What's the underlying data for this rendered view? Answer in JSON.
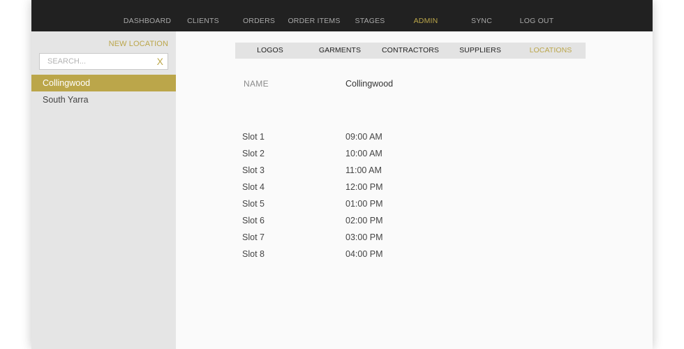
{
  "nav": {
    "items": [
      {
        "label": "DASHBOARD",
        "active": false
      },
      {
        "label": "CLIENTS",
        "active": false
      },
      {
        "label": "ORDERS",
        "active": false
      },
      {
        "label": "ORDER ITEMS",
        "active": false
      },
      {
        "label": "STAGES",
        "active": false
      },
      {
        "label": "ADMIN",
        "active": true
      },
      {
        "label": "SYNC",
        "active": false
      },
      {
        "label": "LOG OUT",
        "active": false
      }
    ]
  },
  "sidebar": {
    "new_location_label": "NEW LOCATION",
    "search": {
      "placeholder": "SEARCH...",
      "value": "",
      "clear_label": "X"
    },
    "locations": [
      {
        "label": "Collingwood",
        "selected": true
      },
      {
        "label": "South Yarra",
        "selected": false
      }
    ]
  },
  "admin_tabs": [
    {
      "label": "LOGOS",
      "active": false
    },
    {
      "label": "GARMENTS",
      "active": false
    },
    {
      "label": "CONTRACTORS",
      "active": false
    },
    {
      "label": "SUPPLIERS",
      "active": false
    },
    {
      "label": "LOCATIONS",
      "active": true
    }
  ],
  "detail": {
    "name_label": "NAME",
    "name_value": "Collingwood",
    "slots": [
      {
        "label": "Slot 1",
        "time": "09:00 AM"
      },
      {
        "label": "Slot 2",
        "time": "10:00 AM"
      },
      {
        "label": "Slot 3",
        "time": "11:00 AM"
      },
      {
        "label": "Slot 4",
        "time": "12:00 PM"
      },
      {
        "label": "Slot 5",
        "time": "01:00 PM"
      },
      {
        "label": "Slot 6",
        "time": "02:00 PM"
      },
      {
        "label": "Slot 7",
        "time": "03:00 PM"
      },
      {
        "label": "Slot 8",
        "time": "04:00 PM"
      }
    ]
  },
  "colors": {
    "accent": "#bba64a",
    "topbar": "#212121",
    "sidebar": "#e5e5e5",
    "subnav": "#e3e3e3"
  }
}
